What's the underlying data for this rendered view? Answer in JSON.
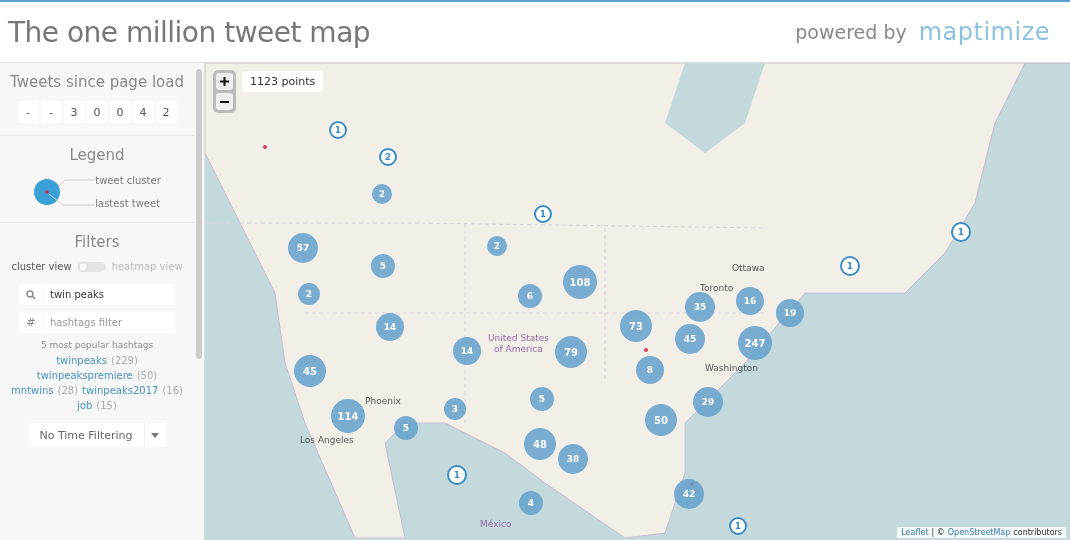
{
  "header": {
    "title": "The one million tweet map",
    "powered_by": "powered by",
    "logo": "maptimize"
  },
  "sidebar": {
    "counter": {
      "title": "Tweets since page load",
      "digits": [
        "-",
        "-",
        "3",
        "0",
        "0",
        "4",
        "2"
      ]
    },
    "legend": {
      "title": "Legend",
      "cluster_label": "tweet cluster",
      "latest_label": "lastest tweet"
    },
    "filters": {
      "title": "Filters",
      "toggle": {
        "left_label": "cluster view",
        "right_label": "heatmap view",
        "on": false
      },
      "search": {
        "value": "twin peaks"
      },
      "hashtag_field": {
        "icon": "#",
        "placeholder": "hashtags filter"
      },
      "popular_title": "5 most popular hashtags",
      "hashtag_rows": [
        [
          {
            "tag": "twinpeaks",
            "count": "(229)"
          }
        ],
        [
          {
            "tag": "twinpeakspremiere",
            "count": "(50)"
          }
        ],
        [
          {
            "tag": "mntwins",
            "count": "(28)"
          },
          {
            "tag": "twinpeaks2017",
            "count": "(16)"
          }
        ],
        [
          {
            "tag": "job",
            "count": "(15)"
          }
        ]
      ],
      "time_filter": "No Time Filtering"
    }
  },
  "map": {
    "points_badge": "1123 points",
    "labels": [
      "Ottawa",
      "Toronto",
      "Washington",
      "United States",
      "of America",
      "Phoenix",
      "Los Angeles",
      "México"
    ],
    "markers": [
      {
        "label": "1",
        "kind": "single"
      },
      {
        "label": "2",
        "kind": "single"
      },
      {
        "label": "2",
        "kind": "cluster"
      },
      {
        "label": "1",
        "kind": "single"
      },
      {
        "label": "57",
        "kind": "cluster"
      },
      {
        "label": "2",
        "kind": "cluster"
      },
      {
        "label": "5",
        "kind": "cluster"
      },
      {
        "label": "108",
        "kind": "cluster"
      },
      {
        "label": "6",
        "kind": "cluster"
      },
      {
        "label": "2",
        "kind": "cluster"
      },
      {
        "label": "14",
        "kind": "cluster"
      },
      {
        "label": "73",
        "kind": "cluster"
      },
      {
        "label": "35",
        "kind": "cluster"
      },
      {
        "label": "16",
        "kind": "cluster"
      },
      {
        "label": "19",
        "kind": "cluster"
      },
      {
        "label": "45",
        "kind": "cluster"
      },
      {
        "label": "247",
        "kind": "cluster"
      },
      {
        "label": "14",
        "kind": "cluster"
      },
      {
        "label": "79",
        "kind": "cluster"
      },
      {
        "label": "45",
        "kind": "cluster"
      },
      {
        "label": "8",
        "kind": "cluster"
      },
      {
        "label": "5",
        "kind": "cluster"
      },
      {
        "label": "29",
        "kind": "cluster"
      },
      {
        "label": "3",
        "kind": "cluster"
      },
      {
        "label": "114",
        "kind": "cluster"
      },
      {
        "label": "5",
        "kind": "cluster"
      },
      {
        "label": "50",
        "kind": "cluster"
      },
      {
        "label": "48",
        "kind": "cluster"
      },
      {
        "label": "38",
        "kind": "cluster"
      },
      {
        "label": "1",
        "kind": "single"
      },
      {
        "label": "4",
        "kind": "cluster"
      },
      {
        "label": "42",
        "kind": "cluster"
      },
      {
        "label": "1",
        "kind": "single"
      },
      {
        "label": "1",
        "kind": "single"
      },
      {
        "label": "1",
        "kind": "single"
      }
    ],
    "attribution": {
      "leaflet": "Leaflet",
      "separator": "| ©",
      "osm": "OpenStreetMap",
      "suffix": "contributors"
    }
  }
}
